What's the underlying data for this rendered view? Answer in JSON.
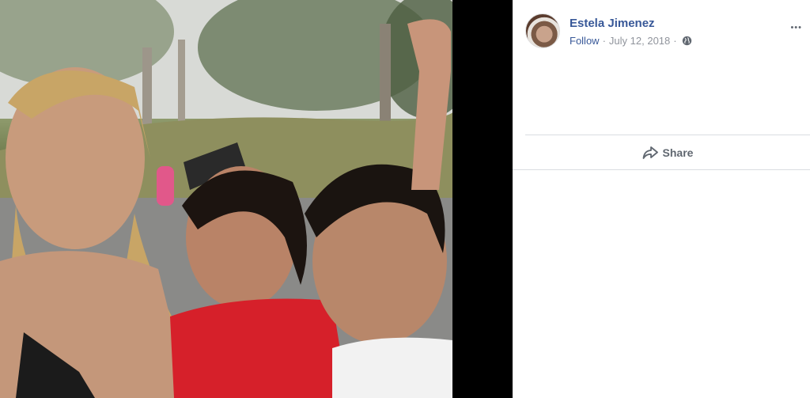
{
  "post": {
    "author": "Estela Jimenez",
    "follow_label": "Follow",
    "separator": "·",
    "date": "July 12, 2018",
    "privacy_icon": "globe-icon",
    "more_icon": "more-options-icon"
  },
  "actions": {
    "share_label": "Share",
    "share_icon": "share-arrow-icon"
  },
  "colors": {
    "link": "#385898",
    "meta": "#90949c",
    "action_text": "#606770",
    "divider": "#dadde1"
  }
}
